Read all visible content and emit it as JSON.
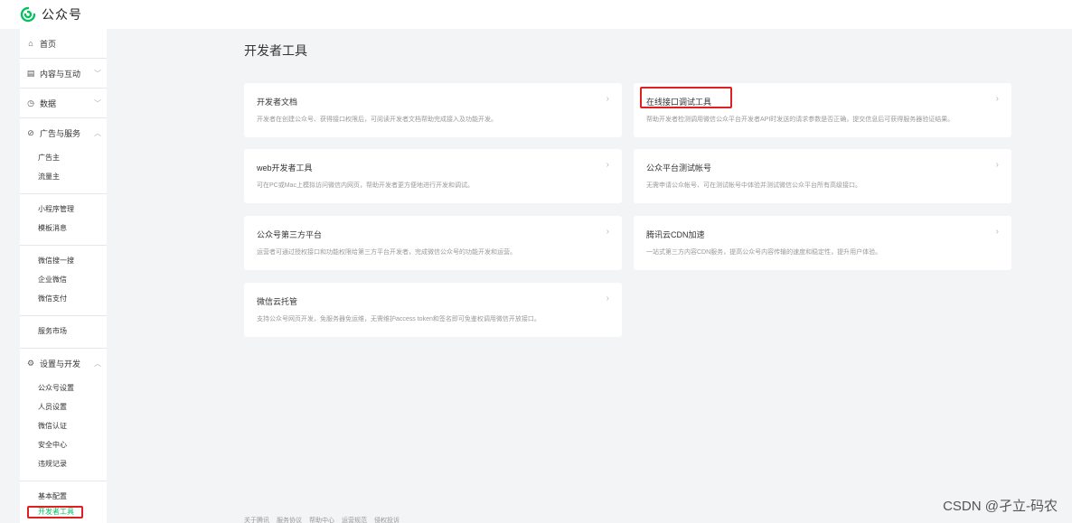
{
  "app": {
    "logo_text": "公众号"
  },
  "sidebar": {
    "home": "首页",
    "content": "内容与互动",
    "data": "数据",
    "ads": "广告与服务",
    "ads_items": [
      "广告主",
      "流量主",
      "小程序管理",
      "模板消息",
      "微信搜一搜",
      "企业微信",
      "微信支付",
      "服务市场"
    ],
    "settings": "设置与开发",
    "settings_items": [
      "公众号设置",
      "人员设置",
      "微信认证",
      "安全中心",
      "违规记录"
    ],
    "basic_config": "基本配置",
    "dev_tools": "开发者工具"
  },
  "main": {
    "title": "开发者工具",
    "cards": [
      {
        "title": "开发者文档",
        "desc": "开发者在创建公众号、获得接口权限后，可阅读开发者文档帮助完成接入及功能开发。"
      },
      {
        "title": "在线接口调试工具",
        "desc": "帮助开发者检测调用微信公众平台开发者API时发送的请求参数是否正确，提交信息后可获得服务器验证结果。"
      },
      {
        "title": "web开发者工具",
        "desc": "可在PC或Mac上模拟访问微信内网页，帮助开发者更方便地进行开发和调试。"
      },
      {
        "title": "公众平台测试帐号",
        "desc": "无需申请公众帐号、可在测试帐号中体验并测试微信公众平台所有高级接口。"
      },
      {
        "title": "公众号第三方平台",
        "desc": "运营者可通过授权接口和功能权限给第三方平台开发者，完成微信公众号的功能开发和运营。"
      },
      {
        "title": "腾讯云CDN加速",
        "desc": "一站式第三方内容CDN服务，提高公众号内容传输的速度和稳定性，提升用户体验。"
      },
      {
        "title": "微信云托管",
        "desc": "支持公众号网页开发，免服务器免运维，无需维护access token和签名即可免鉴权调用微信开放接口。"
      }
    ]
  },
  "footer": {
    "links": [
      "关于腾讯",
      "服务协议",
      "帮助中心",
      "运营规范",
      "侵权投诉"
    ]
  },
  "watermark": "CSDN @孑立-码农"
}
